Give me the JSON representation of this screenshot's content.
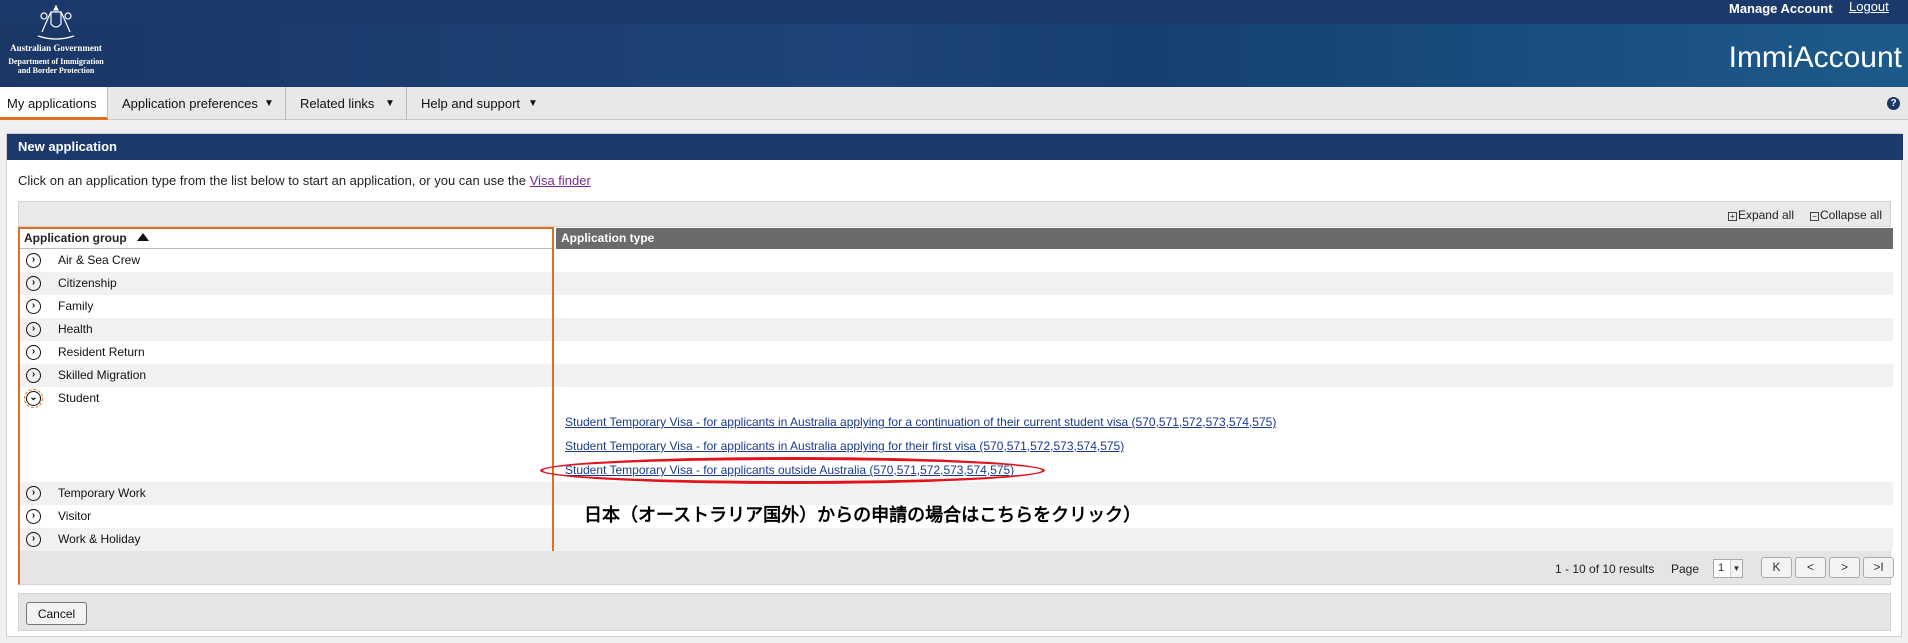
{
  "header": {
    "gov_name": "Australian Government",
    "dept_line1": "Department of Immigration",
    "dept_line2": "and Border Protection",
    "manage_account": "Manage Account",
    "logout": "Logout",
    "brand": "ImmiAccount",
    "colors": {
      "header_bg": "#1b3a6b",
      "accent": "#e07020"
    }
  },
  "nav": {
    "items": [
      {
        "label": "My applications",
        "active": true
      },
      {
        "label": "Application preferences",
        "caret": "▼"
      },
      {
        "label": "Related links",
        "caret": "▼"
      },
      {
        "label": "Help and support",
        "caret": "▼"
      }
    ],
    "help_icon": "?"
  },
  "panel": {
    "title": "New application",
    "intro_text": "Click on an application type from the list below to start an application, or you can use the ",
    "visa_finder": "Visa finder",
    "expand_all": "Expand all",
    "collapse_all": "Collapse all",
    "expand_icon": "⊞",
    "collapse_icon": "⊟"
  },
  "grid": {
    "col_group": "Application group",
    "col_type": "Application type",
    "groups": [
      {
        "label": "Air & Sea Crew",
        "expanded": false
      },
      {
        "label": "Citizenship",
        "expanded": false
      },
      {
        "label": "Family",
        "expanded": false
      },
      {
        "label": "Health",
        "expanded": false
      },
      {
        "label": "Resident Return",
        "expanded": false
      },
      {
        "label": "Skilled Migration",
        "expanded": false
      },
      {
        "label": "Student",
        "expanded": true
      },
      {
        "label": "Temporary Work",
        "expanded": false
      },
      {
        "label": "Visitor",
        "expanded": false
      },
      {
        "label": "Work & Holiday",
        "expanded": false
      }
    ],
    "student_types": [
      "Student Temporary Visa - for applicants in Australia applying for a continuation of their current student visa (570,571,572,573,574,575)",
      "Student Temporary Visa - for applicants in Australia applying for their first visa (570,571,572,573,574,575)",
      "Student Temporary Visa - for applicants outside Australia (570,571,572,573,574,575)"
    ]
  },
  "annotation": {
    "text": "日本（オーストラリア国外）からの申請の場合はこちらをクリック）",
    "color": "#e0141c"
  },
  "pager": {
    "results": "1 - 10 of 10 results",
    "page_label": "Page",
    "page_value": "1",
    "first": "K",
    "prev": "<",
    "next": ">",
    "last": ">I"
  },
  "footer": {
    "cancel": "Cancel"
  }
}
